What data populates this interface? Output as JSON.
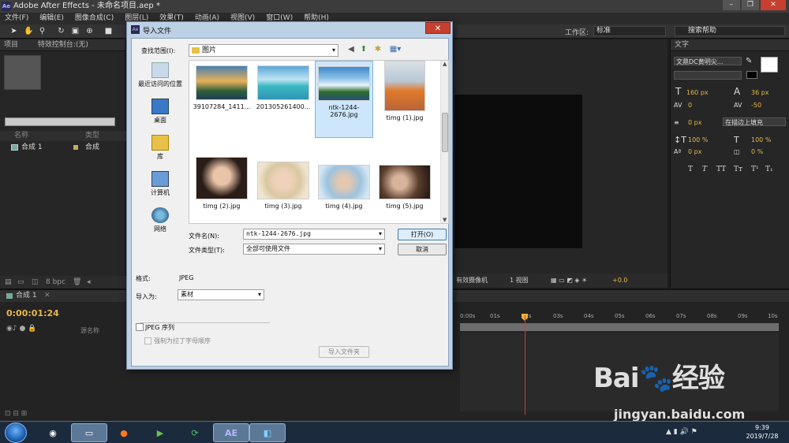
{
  "window": {
    "title": "Adobe After Effects - 未命名项目.aep *",
    "app_icon": "Ae"
  },
  "menu": [
    "文件(F)",
    "编辑(E)",
    "图像合成(C)",
    "图层(L)",
    "效果(T)",
    "动画(A)",
    "视图(V)",
    "窗口(W)",
    "帮助(H)"
  ],
  "toolbar": {
    "workspace_label": "工作区:",
    "workspace_value": "标准",
    "search_help": "搜索帮助"
  },
  "project_panel": {
    "tabs": [
      "项目",
      "特效控制台:(无)"
    ],
    "col_name": "名称",
    "col_type": "类型",
    "item_name": "合成 1",
    "item_type": "合成",
    "bpc": "8 bpc"
  },
  "viewer": {
    "camera": "有效摄像机",
    "views": "1 视图",
    "offset": "+0.0"
  },
  "character_panel": {
    "tab": "文字",
    "font": "文鼎DC黄明尖...",
    "font_size": "160 px",
    "leading": "36 px",
    "kerning": "0",
    "tracking": "-50",
    "indent": "0 px",
    "stroke_mode": "在描边上填充",
    "vscale": "100 %",
    "hscale": "100 %",
    "baseline": "0 px",
    "tsume": "0 %",
    "styles": [
      "T",
      "T",
      "TT",
      "Tт",
      "T¹",
      "T₁"
    ]
  },
  "timeline": {
    "tab": "合成 1",
    "timecode": "0:00:01:24",
    "layer_col": "源名称",
    "ruler": [
      "0:00s",
      "01s",
      "02s",
      "03s",
      "04s",
      "05s",
      "06s",
      "07s",
      "08s",
      "09s",
      "10s"
    ]
  },
  "dialog": {
    "title": "导入文件",
    "look_in_label": "查找范围(I):",
    "look_in_value": "图片",
    "places": [
      "最近访问的位置",
      "桌面",
      "库",
      "计算机",
      "网络"
    ],
    "files": [
      {
        "name": "39107284_1411...",
        "selected": false
      },
      {
        "name": "201305261400...",
        "selected": false
      },
      {
        "name": "ntk-1244-2676.jpg",
        "selected": true
      },
      {
        "name": "timg (1).jpg",
        "selected": false
      },
      {
        "name": "timg (2).jpg",
        "selected": false
      },
      {
        "name": "timg (3).jpg",
        "selected": false
      },
      {
        "name": "timg (4).jpg",
        "selected": false
      },
      {
        "name": "timg (5).jpg",
        "selected": false
      }
    ],
    "filename_label": "文件名(N):",
    "filename_value": "ntk-1244-2676.jpg",
    "filetype_label": "文件类型(T):",
    "filetype_value": "全部可使用文件",
    "open_button": "打开(O)",
    "cancel_button": "取消",
    "format_label": "格式:",
    "format_value": "JPEG",
    "import_as_label": "导入为:",
    "import_as_value": "素材",
    "jpeg_sequence_label": "JPEG 序列",
    "force_alpha_label": "强制为拉丁字母顺序",
    "import_folder_button": "导入文件夹"
  },
  "taskbar": {
    "time": "9:39",
    "date": "2019/7/28",
    "ae_label": "AE"
  },
  "watermark": {
    "brand": "Bai",
    "brand_cn": "经验",
    "url": "jingyan.baidu.com"
  }
}
